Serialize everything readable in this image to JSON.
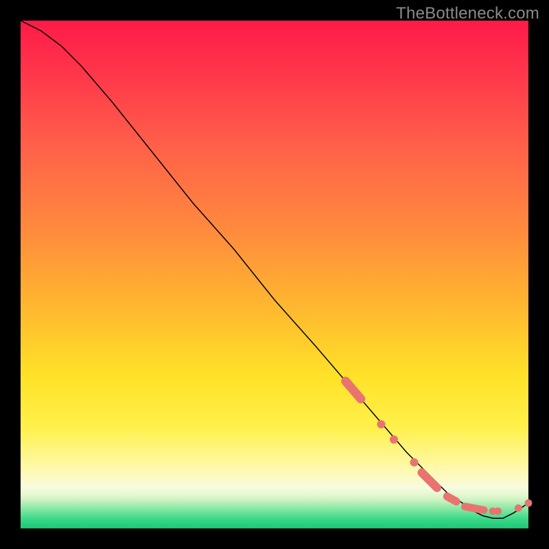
{
  "watermark": "TheBottleneck.com",
  "chart_data": {
    "type": "line",
    "title": "",
    "xlabel": "",
    "ylabel": "",
    "xlim": [
      0,
      100
    ],
    "ylim": [
      0,
      100
    ],
    "grid": false,
    "legend": false,
    "series": [
      {
        "name": "bottleneck-curve",
        "x": [
          0,
          4,
          8,
          12,
          18,
          26,
          34,
          42,
          50,
          58,
          64,
          70,
          76,
          80,
          84,
          87,
          89,
          91,
          93,
          95,
          97,
          100
        ],
        "y": [
          100,
          98,
          95,
          91,
          84,
          74,
          64,
          55,
          45,
          36,
          29,
          22,
          15,
          11,
          7,
          5,
          3.5,
          2.5,
          2,
          2,
          3,
          5
        ]
      }
    ],
    "markers": {
      "top_run": {
        "x": [
          64,
          67
        ],
        "y": [
          29,
          25.5
        ]
      },
      "mid_dots": {
        "x": [
          71,
          73.5,
          77.5
        ],
        "y": [
          20.5,
          17.5,
          13
        ]
      },
      "low_run": {
        "x": [
          79,
          82
        ],
        "y": [
          11,
          8
        ]
      },
      "floor_dots": {
        "x": [
          84,
          85,
          85.8,
          87.5,
          88.3,
          89.2,
          90.2,
          91.2,
          93,
          94,
          98,
          100
        ],
        "y": [
          6.3,
          5.7,
          5.3,
          4.3,
          4.1,
          3.9,
          3.7,
          3.6,
          3.4,
          3.4,
          4,
          5
        ]
      }
    },
    "colors": {
      "curve": "#000000",
      "marker": "#e9746f",
      "gradient_top": "#ff1a48",
      "gradient_mid": "#ffe228",
      "gradient_bottom": "#17c972"
    }
  }
}
